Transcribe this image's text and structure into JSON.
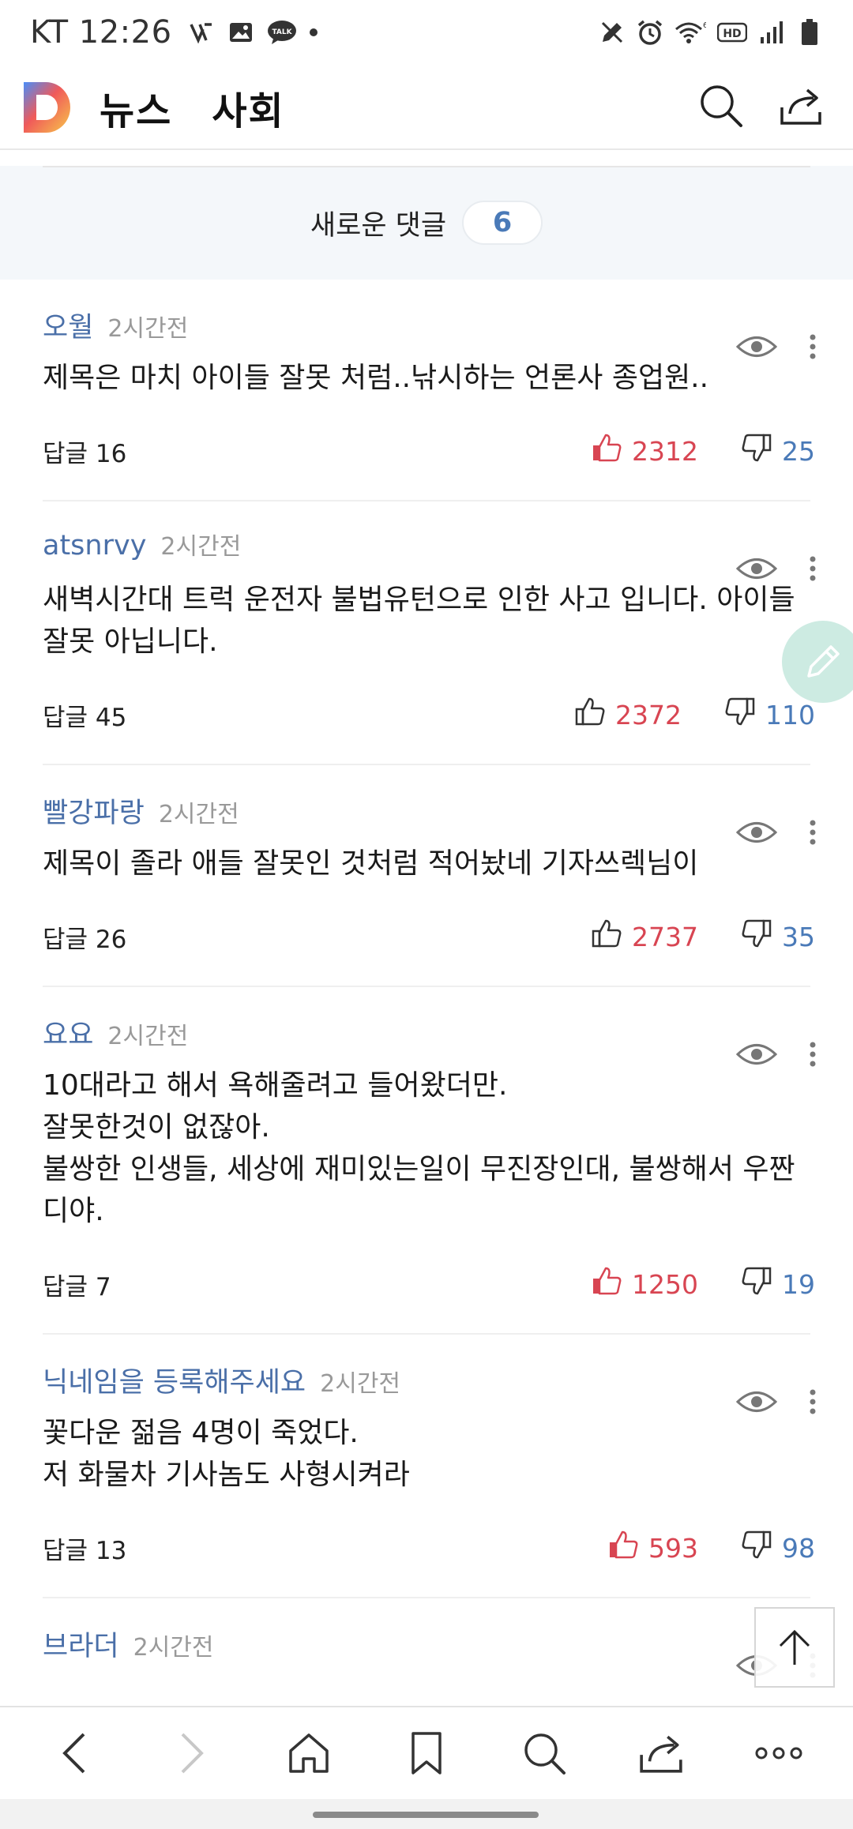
{
  "status_bar": {
    "carrier_time": "KT 12:26",
    "icons_left": [
      "vlog-icon",
      "gallery-icon",
      "talk-icon",
      "dot"
    ],
    "icons_right": [
      "edit-icon",
      "alarm-icon",
      "wifi-6-icon",
      "hd-icon",
      "signal-icon",
      "battery-icon"
    ],
    "talk_text": "TALK",
    "hd_text": "HD"
  },
  "header": {
    "app_title": "뉴스",
    "section_title": "사회",
    "logo_letter": "D"
  },
  "banner": {
    "label": "새로운 댓글",
    "count": "6"
  },
  "comments": [
    {
      "name": "오월",
      "time": "2시간전",
      "body": "제목은 마치 아이들 잘못 처럼..낚시하는 언론사 종업원..",
      "reply": "답글 16",
      "likes": "2312",
      "dislikes": "25",
      "liked": true
    },
    {
      "name": "atsnrvy",
      "time": "2시간전",
      "body": "새벽시간대 트럭 운전자 불법유턴으로 인한 사고 입니다. 아이들\n잘못 아닙니다.",
      "reply": "답글 45",
      "likes": "2372",
      "dislikes": "110",
      "liked": false
    },
    {
      "name": "빨강파랑",
      "time": "2시간전",
      "body": "제목이 졸라 애들 잘못인 것처럼 적어놨네 기자쓰렉님이",
      "reply": "답글 26",
      "likes": "2737",
      "dislikes": "35",
      "liked": false
    },
    {
      "name": "요요",
      "time": "2시간전",
      "body": "10대라고 해서 욕해줄려고 들어왔더만.\n잘못한것이 없잖아.\n불쌍한 인생들,  세상에 재미있는일이 무진장인대,  불쌍해서 우짠\n디야.",
      "reply": "답글 7",
      "likes": "1250",
      "dislikes": "19",
      "liked": true
    },
    {
      "name": "닉네임을 등록해주세요",
      "time": "2시간전",
      "body": "꽃다운 젊음 4명이 죽었다.\n저 화물차 기사놈도 사형시켜라",
      "reply": "답글 13",
      "likes": "593",
      "dislikes": "98",
      "liked": true
    },
    {
      "name": "브라더",
      "time": "2시간전",
      "body": "",
      "reply": "",
      "likes": "",
      "dislikes": "",
      "liked": false
    }
  ],
  "colors": {
    "accent_blue": "#4a7ab8",
    "like_red": "#d84552",
    "banner_bg": "#f4f7fa",
    "fab_green": "#cdebe2"
  },
  "bottom_nav": [
    "back-icon",
    "forward-icon",
    "home-icon",
    "bookmark-icon",
    "search-icon",
    "share-icon",
    "more-icon"
  ]
}
